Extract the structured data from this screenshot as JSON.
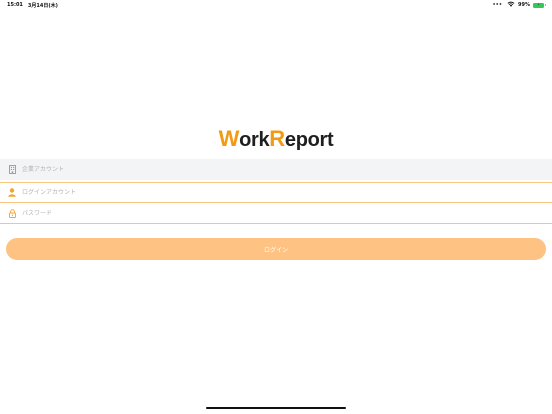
{
  "status_bar": {
    "time": "15:01",
    "date": "3月14日(木)",
    "battery_percent": "99%",
    "dots": "•••"
  },
  "logo": {
    "w_letter": "W",
    "ork": "ork",
    "r_letter": "R",
    "eport": "eport",
    "accent_color": "#f39a15"
  },
  "form": {
    "company_placeholder": "企業アカウント",
    "account_placeholder": "ログインアカウント",
    "password_placeholder": "パスワード",
    "login_label": "ログイン"
  },
  "colors": {
    "button_bg": "#fec282",
    "field_border": "#f8c57f",
    "icon_accent": "#f0a531"
  },
  "icons": {
    "company": "building-icon",
    "account": "user-icon",
    "password": "lock-icon"
  }
}
